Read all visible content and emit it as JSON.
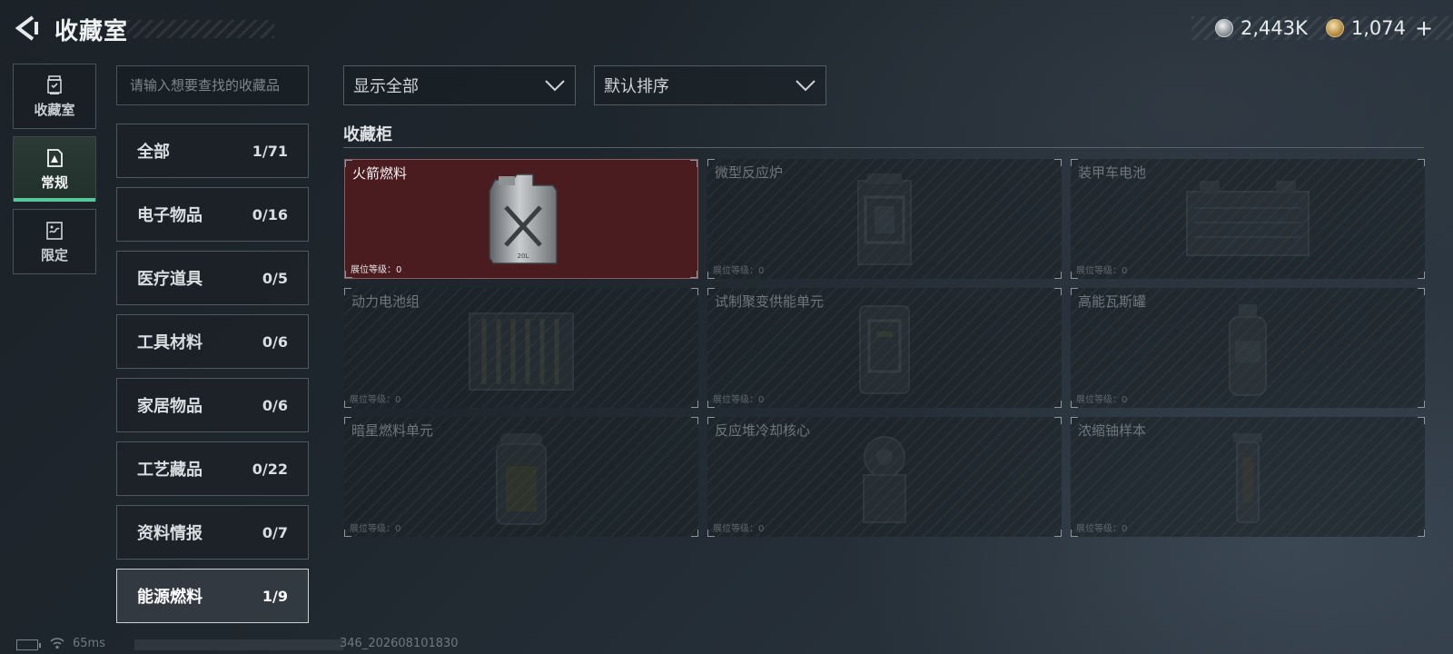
{
  "header": {
    "title": "收藏室",
    "back_icon": "back-arrow-icon",
    "currency": [
      {
        "icon": "silver-coin-icon",
        "value": "2,443K"
      },
      {
        "icon": "gold-coin-icon",
        "value": "1,074"
      }
    ],
    "add_label": "+"
  },
  "left_tabs": [
    {
      "label": "收藏室",
      "icon": "collection-room-icon"
    },
    {
      "label": "常规",
      "icon": "regular-card-icon",
      "active": true
    },
    {
      "label": "限定",
      "icon": "limited-card-icon"
    }
  ],
  "search": {
    "placeholder": "请输入想要查找的收藏品",
    "value": ""
  },
  "subcategories": [
    {
      "name": "全部",
      "count": "1/71"
    },
    {
      "name": "电子物品",
      "count": "0/16"
    },
    {
      "name": "医疗道具",
      "count": "0/5"
    },
    {
      "name": "工具材料",
      "count": "0/6"
    },
    {
      "name": "家居物品",
      "count": "0/6"
    },
    {
      "name": "工艺藏品",
      "count": "0/22"
    },
    {
      "name": "资料情报",
      "count": "0/7"
    },
    {
      "name": "能源燃料",
      "count": "1/9",
      "selected": true
    }
  ],
  "filters": {
    "display": "显示全部",
    "sort": "默认排序"
  },
  "cabinet": {
    "title": "收藏柜",
    "slots": [
      {
        "name": "火箭燃料",
        "level_label": "展位等级：0",
        "owned": true,
        "icon": "jerrycan-icon"
      },
      {
        "name": "微型反应炉",
        "level_label": "展位等级：0",
        "owned": false,
        "icon": "reactor-icon"
      },
      {
        "name": "装甲车电池",
        "level_label": "展位等级：0",
        "owned": false,
        "icon": "battery-icon"
      },
      {
        "name": "动力电池组",
        "level_label": "展位等级：0",
        "owned": false,
        "icon": "battery-pack-icon"
      },
      {
        "name": "试制聚变供能单元",
        "level_label": "展位等级：0",
        "owned": false,
        "icon": "fusion-unit-icon"
      },
      {
        "name": "高能瓦斯罐",
        "level_label": "展位等级：0",
        "owned": false,
        "icon": "gas-tank-icon"
      },
      {
        "name": "暗星燃料单元",
        "level_label": "展位等级：0",
        "owned": false,
        "icon": "fuel-cell-icon"
      },
      {
        "name": "反应堆冷却核心",
        "level_label": "展位等级：0",
        "owned": false,
        "icon": "cooling-core-icon"
      },
      {
        "name": "浓缩铀样本",
        "level_label": "展位等级：0",
        "owned": false,
        "icon": "uranium-sample-icon"
      }
    ]
  },
  "footer": {
    "ping": "65ms",
    "build": "346_202608101830"
  },
  "colors": {
    "accent_green": "#58c79b",
    "owned_slot_bg": "#4a1b1f"
  }
}
